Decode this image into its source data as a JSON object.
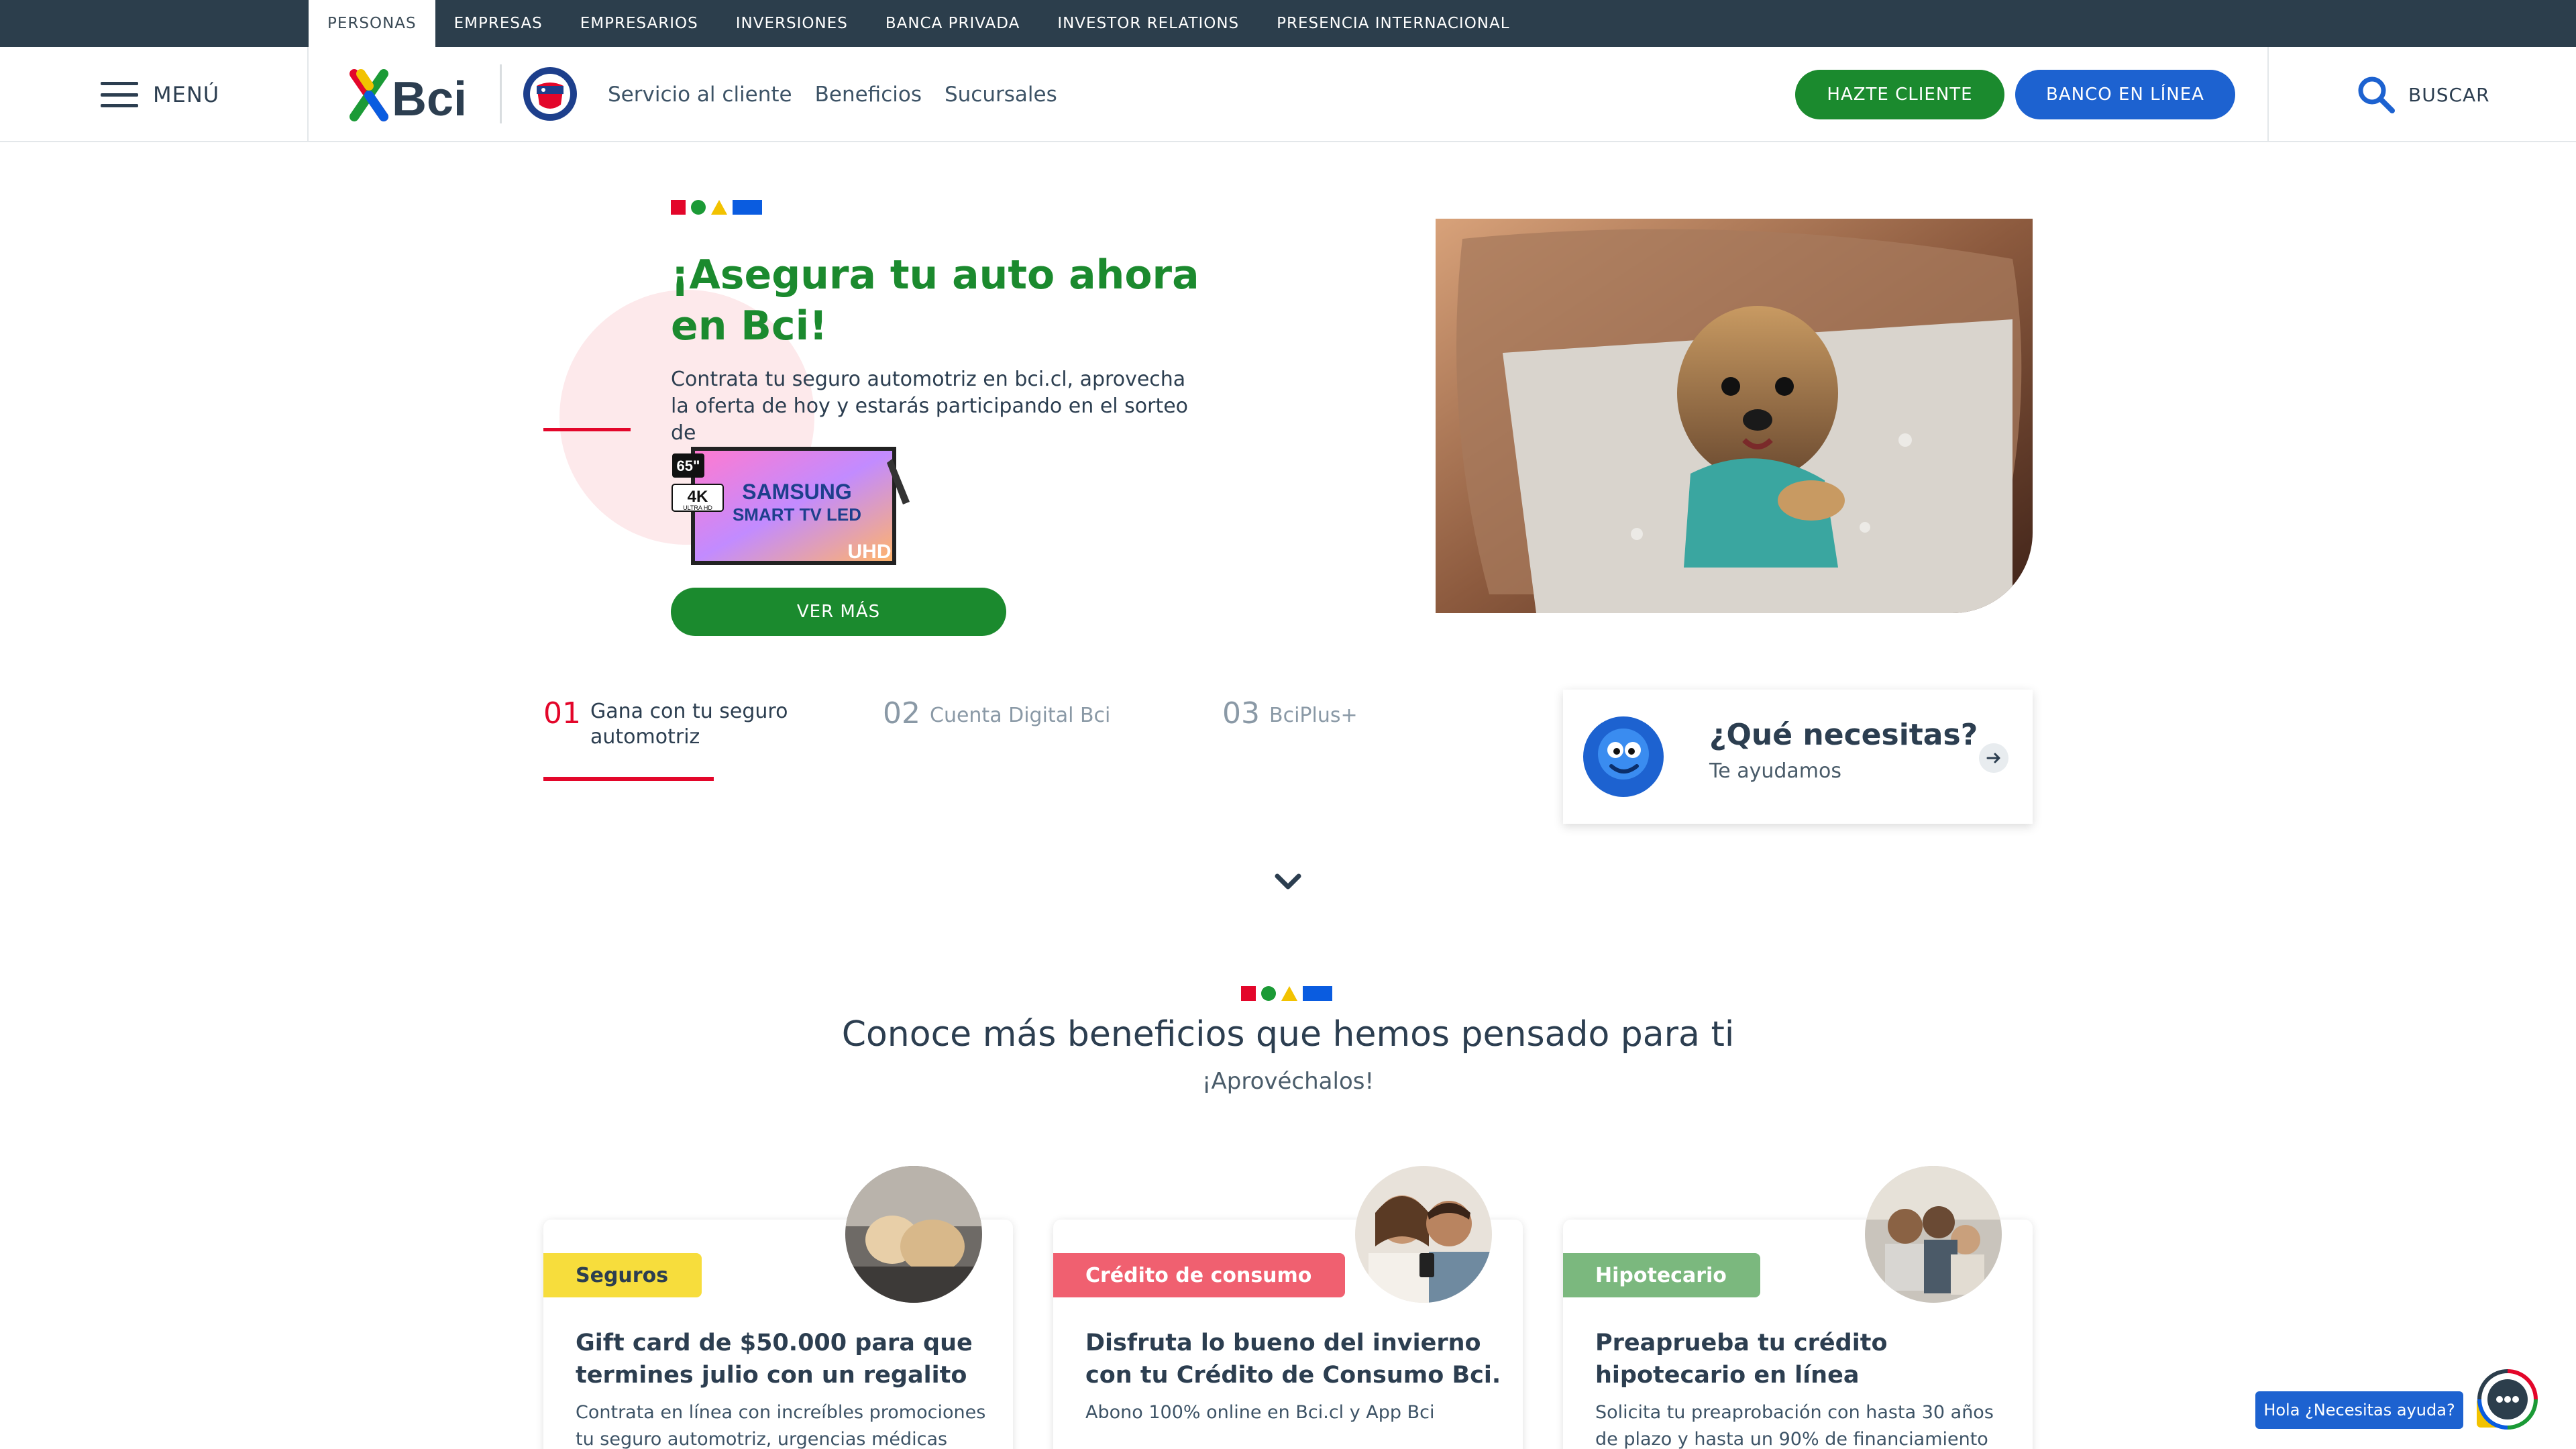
{
  "topbar": {
    "tabs": [
      "PERSONAS",
      "EMPRESAS",
      "EMPRESARIOS",
      "INVERSIONES",
      "BANCA PRIVADA",
      "INVESTOR RELATIONS",
      "PRESENCIA INTERNACIONAL"
    ],
    "active": "PERSONAS"
  },
  "nav": {
    "menu_label": "MENÚ",
    "logo_text": "Bci",
    "links": [
      "Servicio al cliente",
      "Beneficios",
      "Sucursales"
    ],
    "hazte_cliente": "HAZTE CLIENTE",
    "banco_en_linea": "BANCO EN LÍNEA",
    "search_label": "BUSCAR"
  },
  "hero": {
    "title": "¡Asegura tu auto ahora en Bci!",
    "text": "Contrata tu seguro automotriz en bci.cl, aprovecha la oferta de hoy y estarás participando en el sorteo de",
    "tv": {
      "size": "65\"",
      "res": "4K",
      "res_sub": "ULTRA HD",
      "brand": "SAMSUNG",
      "model": "SMART TV LED",
      "tag": "UHD"
    },
    "cta": "VER MÁS"
  },
  "slider": {
    "tabs": [
      {
        "num": "01",
        "label": "Gana con tu seguro automotriz"
      },
      {
        "num": "02",
        "label": "Cuenta Digital Bci"
      },
      {
        "num": "03",
        "label": "BciPlus+"
      }
    ]
  },
  "help": {
    "title": "¿Qué necesitas?",
    "subtitle": "Te ayudamos"
  },
  "benefits": {
    "title": "Conoce más beneficios que hemos pensado para ti",
    "subtitle": "¡Aprovéchalos!",
    "cards": [
      {
        "tag": "Seguros",
        "tag_color": "#f7dd3c",
        "tag_text_color": "#2c3e50",
        "title": "Gift card de $50.000 para que termines julio con un regalito",
        "desc": "Contrata en línea con increíbles promociones tu seguro automotriz, urgencias médicas"
      },
      {
        "tag": "Crédito de consumo",
        "tag_color": "#f06070",
        "tag_text_color": "#ffffff",
        "title": "Disfruta lo bueno del invierno con tu Crédito de Consumo Bci.",
        "desc": "Abono 100% online en Bci.cl y App Bci"
      },
      {
        "tag": "Hipotecario",
        "tag_color": "#7bb87e",
        "tag_text_color": "#ffffff",
        "title": "Preaprueba tu crédito hipotecario en línea",
        "desc": "Solicita tu preaprobación con hasta 30 años de plazo y hasta un 90% de financiamiento"
      }
    ]
  },
  "chat": {
    "label": "Hola ¿Necesitas ayuda?"
  },
  "colors": {
    "green": "#1b8a2e",
    "blue": "#1d62d0",
    "red": "#e3062a",
    "dark": "#2c3e4c"
  }
}
